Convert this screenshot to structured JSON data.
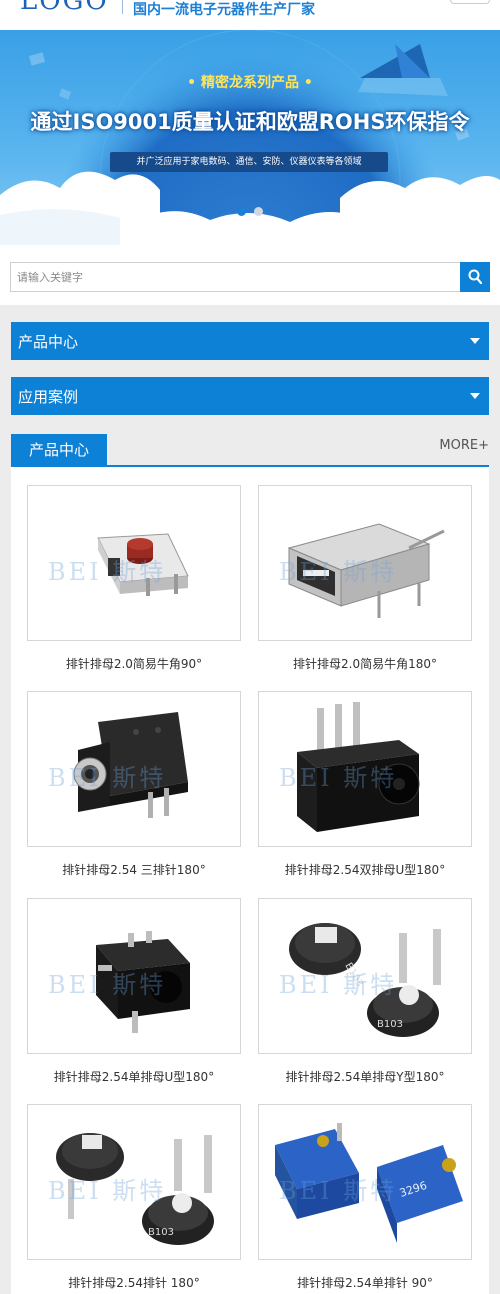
{
  "header": {
    "logo": "LOGO",
    "slogan": "国内一流电子元器件生产厂家"
  },
  "banner": {
    "subtitle": "• 精密龙系列产品 •",
    "title": "通过ISO9001质量认证和欧盟ROHS环保指令",
    "tagline": "并广泛应用于家电数码、通信、安防、仪器仪表等各领域",
    "slides": 2,
    "active_slide": 1
  },
  "search": {
    "placeholder": "请输入关键字",
    "icon": "search-icon"
  },
  "menus": [
    {
      "label": "产品中心",
      "icon": "caret-down-icon"
    },
    {
      "label": "应用案例",
      "icon": "caret-down-icon"
    }
  ],
  "products": {
    "tab_label": "产品中心",
    "more_label": "MORE+",
    "watermark": "BEI 斯特",
    "items": [
      {
        "caption": "排针排母2.0简易牛角90°",
        "image": "tact-switch-red"
      },
      {
        "caption": "排针排母2.0简易牛角180°",
        "image": "usb-connector"
      },
      {
        "caption": "排针排母2.54 三排针180°",
        "image": "audio-jack-round"
      },
      {
        "caption": "排针排母2.54双排母U型180°",
        "image": "dc-jack-pins-up"
      },
      {
        "caption": "排针排母2.54单排母U型180°",
        "image": "dc-jack-black"
      },
      {
        "caption": "排针排母2.54单排母Y型180°",
        "image": "trimmer-potentiometer-pair"
      },
      {
        "caption": "排针排母2.54排针 180°",
        "image": "trimmer-potentiometer-pair-2"
      },
      {
        "caption": "排针排母2.54单排针 90°",
        "image": "blue-trimmer-3296"
      }
    ]
  },
  "colors": {
    "brand_blue": "#0d81d6",
    "banner_blue": "#3aa0e6",
    "yellow_text": "#ffe45c"
  }
}
